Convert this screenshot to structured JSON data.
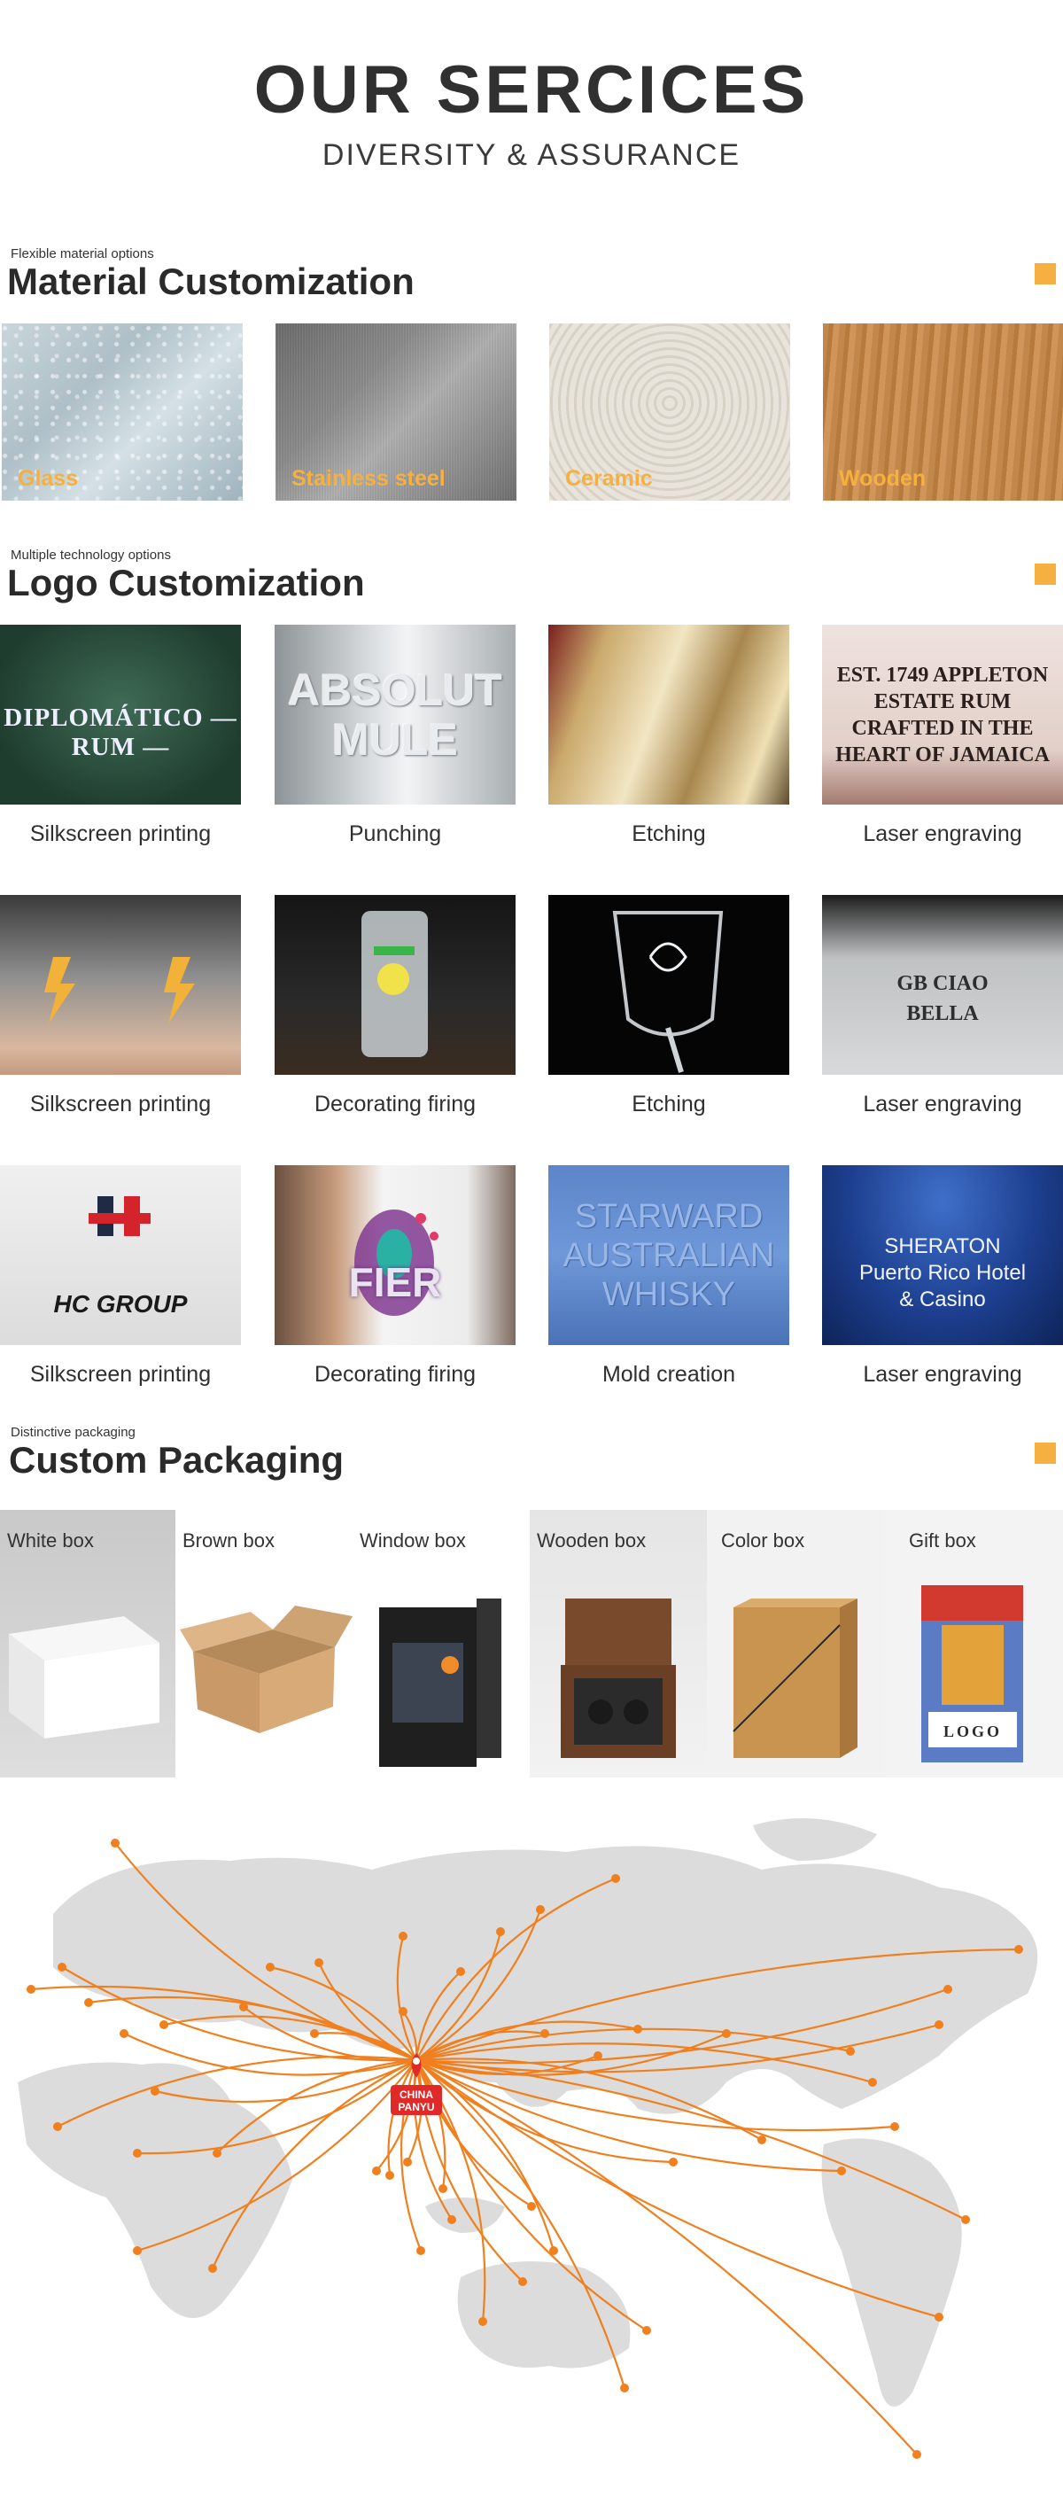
{
  "header": {
    "title": "OUR SERCICES",
    "subtitle": "DIVERSITY & ASSURANCE"
  },
  "accent_color": "#f5b041",
  "material": {
    "kicker": "Flexible material options",
    "title": "Material Customization",
    "items": [
      {
        "label": "Glass",
        "icon": "glass-texture"
      },
      {
        "label": "Stainless steel",
        "icon": "steel-texture"
      },
      {
        "label": "Ceramic",
        "icon": "ceramic-texture"
      },
      {
        "label": "Wooden",
        "icon": "wood-texture"
      }
    ]
  },
  "logo": {
    "kicker": "Multiple technology options",
    "title": "Logo Customization",
    "rows": [
      [
        {
          "caption": "Silkscreen printing",
          "photo_text": "DIPLOMÁTICO — RUM —"
        },
        {
          "caption": "Punching",
          "photo_text": "ABSOLUT MULE"
        },
        {
          "caption": "Etching",
          "photo_text": ""
        },
        {
          "caption": "Laser engraving",
          "photo_text": "EST. 1749 APPLETON ESTATE RUM CRAFTED IN THE HEART OF JAMAICA"
        }
      ],
      [
        {
          "caption": "Silkscreen printing",
          "photo_text": ""
        },
        {
          "caption": "Decorating firing",
          "photo_text": ""
        },
        {
          "caption": "Etching",
          "photo_text": ""
        },
        {
          "caption": "Laser engraving",
          "photo_text": "GB CIAO BELLA"
        }
      ],
      [
        {
          "caption": "Silkscreen printing",
          "photo_text": "HC GROUP"
        },
        {
          "caption": "Decorating firing",
          "photo_text": "FIER"
        },
        {
          "caption": "Mold creation",
          "photo_text": "STARWARD AUSTRALIAN WHISKY"
        },
        {
          "caption": "Laser engraving",
          "photo_text": "SHERATON Puerto Rico Hotel & Casino"
        }
      ]
    ]
  },
  "packaging": {
    "kicker": "Distinctive packaging",
    "title": "Custom Packaging",
    "items": [
      {
        "label": "White box"
      },
      {
        "label": "Brown box"
      },
      {
        "label": "Window box"
      },
      {
        "label": "Wooden box"
      },
      {
        "label": "Color box"
      },
      {
        "label": "Gift box",
        "box_text": "LOGO"
      }
    ]
  },
  "map": {
    "origin_label_1": "CHINA",
    "origin_label_2": "PANYU",
    "route_color": "#f07f1e"
  }
}
